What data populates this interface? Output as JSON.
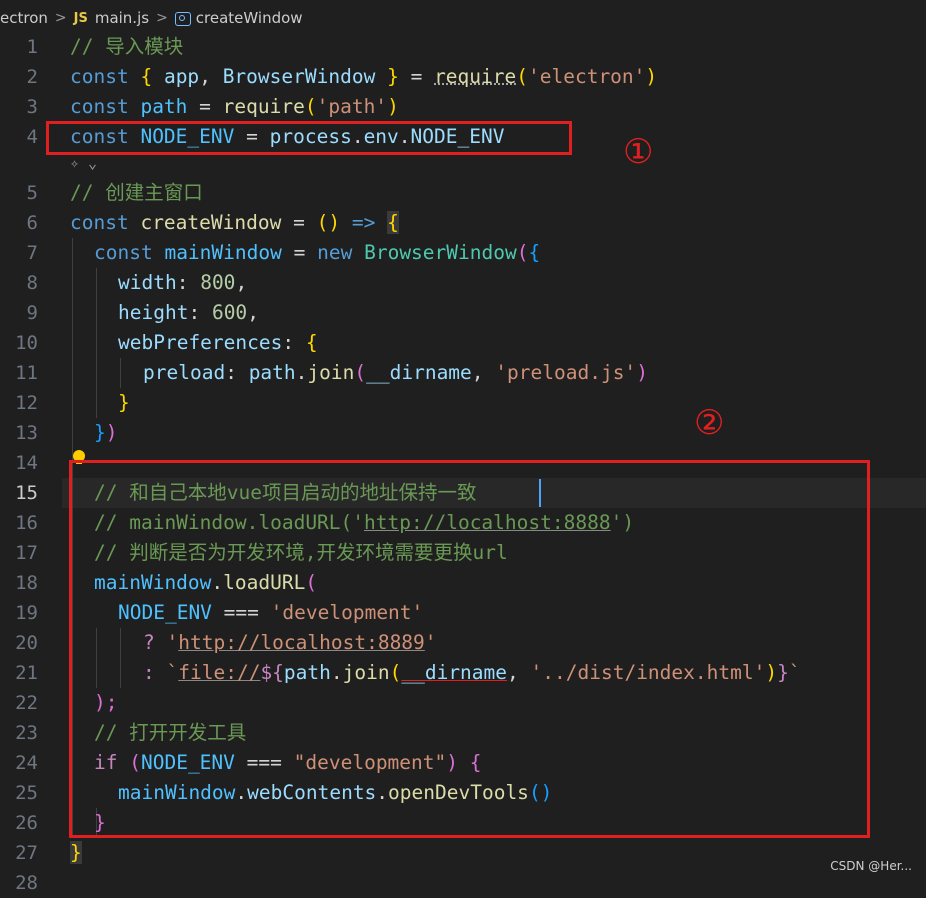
{
  "breadcrumb": {
    "folder": "ectron",
    "file_badge": "JS",
    "file": "main.js",
    "symbol": "createWindow",
    "separator": ">"
  },
  "colors": {
    "highlight": "#e02020",
    "keyword": "#569cd6",
    "string": "#ce9178",
    "comment": "#6a9955",
    "function": "#dcdcaa",
    "variable": "#9cdcfe"
  },
  "annotations": {
    "box1_label": "①",
    "box2_label": "②"
  },
  "gutter": {
    "line_numbers": [
      "1",
      "2",
      "3",
      "4",
      "5",
      "6",
      "7",
      "8",
      "9",
      "10",
      "11",
      "12",
      "13",
      "14",
      "15",
      "16",
      "17",
      "18",
      "19",
      "20",
      "21",
      "22",
      "23",
      "24",
      "25",
      "26",
      "27",
      "28"
    ],
    "active_line": "15"
  },
  "code": {
    "l1": {
      "comment": "// 导入模块"
    },
    "l2": {
      "kw": "const",
      "open": "{",
      "app": "app",
      "comma": ",",
      "bw": "BrowserWindow",
      "close": "}",
      "eq": "=",
      "req": "require",
      "p1": "(",
      "arg": "'electron'",
      "p2": ")"
    },
    "l3": {
      "kw": "const",
      "name": "path",
      "eq": "=",
      "req": "require",
      "p1": "(",
      "arg": "'path'",
      "p2": ")"
    },
    "l4": {
      "kw": "const",
      "name": "NODE_ENV",
      "eq": "=",
      "process": "process",
      "dot1": ".",
      "env": "env",
      "dot2": ".",
      "prop": "NODE_ENV"
    },
    "l5": {
      "comment": "// 创建主窗口"
    },
    "l6": {
      "kw": "const",
      "name": "createWindow",
      "eq": "=",
      "params": "()",
      "arrow": "=>",
      "brace": "{"
    },
    "l7": {
      "kw": "const",
      "name": "mainWindow",
      "eq": "=",
      "new": "new",
      "cls": "BrowserWindow",
      "p": "(",
      "b": "{"
    },
    "l8": {
      "key": "width",
      "colon": ":",
      "val": "800",
      "comma": ","
    },
    "l9": {
      "key": "height",
      "colon": ":",
      "val": "600",
      "comma": ","
    },
    "l10": {
      "key": "webPreferences",
      "colon": ":",
      "brace": "{"
    },
    "l11": {
      "key": "preload",
      "colon": ":",
      "obj": "path",
      "dot": ".",
      "fn": "join",
      "p1": "(",
      "dir": "__dirname",
      "comma": ",",
      "arg": "'preload.js'",
      "p2": ")"
    },
    "l12": {
      "brace": "}"
    },
    "l13": {
      "b": "}",
      "p": ")"
    },
    "l15": {
      "comment": "// 和自己本地vue项目启动的地址保持一致"
    },
    "l16": {
      "comment_pre": "// mainWindow.loadURL('",
      "link": "http://localhost:8888",
      "comment_post": "')"
    },
    "l17": {
      "comment": "// 判断是否为开发环境,开发环境需要更换url"
    },
    "l18": {
      "obj": "mainWindow",
      "dot": ".",
      "fn": "loadURL",
      "p": "("
    },
    "l19": {
      "name": "NODE_ENV",
      "op": "===",
      "val": "'development'"
    },
    "l20": {
      "q": "?",
      "q1": "'",
      "url": "http://localhost:8889",
      "q2": "'"
    },
    "l21": {
      "colon": ":",
      "tick": "`",
      "proto": "file://",
      "dollar": "${",
      "obj": "path",
      "dot": ".",
      "fn": "join",
      "p1": "(",
      "dir": "__dirname",
      "comma": ",",
      "arg": "'../dist/index.html'",
      "p2": ")",
      "close": "}",
      "tick2": "`"
    },
    "l22": {
      "text": ");"
    },
    "l23": {
      "comment": "// 打开开发工具"
    },
    "l24": {
      "kw": "if",
      "p1": "(",
      "name": "NODE_ENV",
      "op": "===",
      "val": "\"development\"",
      "p2": ")",
      "brace": "{"
    },
    "l25": {
      "obj": "mainWindow",
      "dot1": ".",
      "prop": "webContents",
      "dot2": ".",
      "fn": "openDevTools",
      "parens": "()"
    },
    "l26": {
      "brace": "}"
    },
    "l27": {
      "brace": "}"
    }
  },
  "watermark": "CSDN @Her..."
}
